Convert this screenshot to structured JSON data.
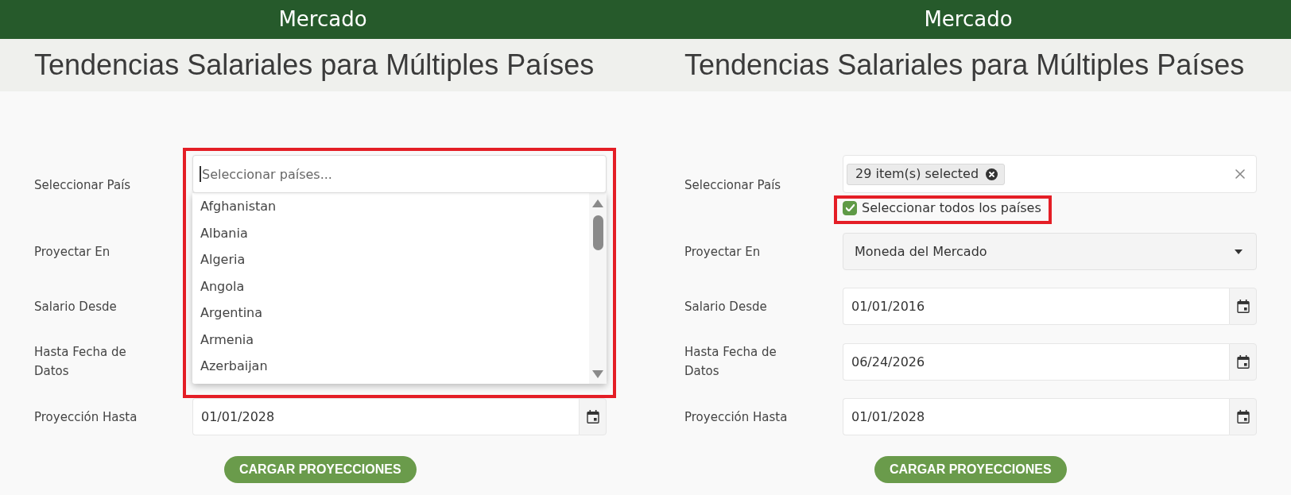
{
  "panels": [
    {
      "header": "Mercado",
      "title": "Tendencias Salariales para Múltiples Países",
      "fields": [
        {
          "kind": "multiselect",
          "label": "Seleccionar País",
          "open": true,
          "highlighted": true,
          "search": {
            "placeholder": "Seleccionar países...",
            "focused": true
          },
          "options": [
            "Afghanistan",
            "Albania",
            "Algeria",
            "Angola",
            "Argentina",
            "Armenia",
            "Azerbaijan"
          ]
        },
        {
          "kind": "select",
          "label": "Proyectar En"
        },
        {
          "kind": "date",
          "label": "Salario Desde"
        },
        {
          "kind": "date",
          "label": "Hasta Fecha de Datos"
        },
        {
          "kind": "date",
          "label": "Proyección Hasta",
          "value": "01/01/2028"
        }
      ],
      "button": "CARGAR PROYECCIONES"
    },
    {
      "header": "Mercado",
      "title": "Tendencias Salariales para Múltiples Países",
      "fields": [
        {
          "kind": "multiselect",
          "label": "Seleccionar País",
          "open": false,
          "chip": "29 item(s) selected",
          "select_all": {
            "label": "Seleccionar todos los países",
            "checked": true,
            "highlighted": true
          }
        },
        {
          "kind": "select",
          "label": "Proyectar En",
          "value": "Moneda del Mercado"
        },
        {
          "kind": "date",
          "label": "Salario Desde",
          "value": "01/01/2016"
        },
        {
          "kind": "date",
          "label": "Hasta Fecha de Datos",
          "value": "06/24/2026"
        },
        {
          "kind": "date",
          "label": "Proyección Hasta",
          "value": "01/01/2028"
        }
      ],
      "button": "CARGAR PROYECCIONES"
    }
  ]
}
